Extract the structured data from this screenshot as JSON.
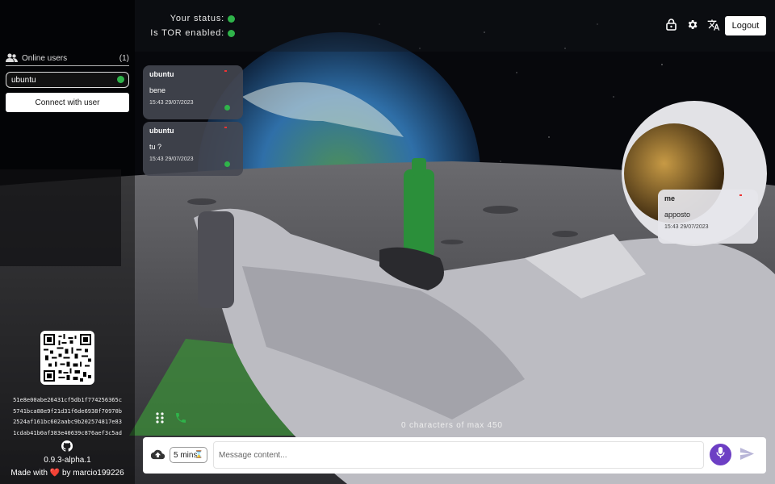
{
  "app": {
    "status_label": "Your status:",
    "tor_label": "Is TOR enabled:",
    "logout_label": "Logout",
    "icons": [
      "lock-icon",
      "gear-icon",
      "translate-icon"
    ]
  },
  "sidebar": {
    "online_users_label": "Online users",
    "online_users_count": "(1)",
    "users": [
      {
        "name": "ubuntu",
        "status_color": "#2fb34a"
      }
    ],
    "connect_label": "Connect with user",
    "fingerprint": [
      "51e8e00abe26431cf5db1f774256365c",
      "5741bca88e9f21d31f6de6938f70970b",
      "2524af161bc602aabc9b202574817e83",
      "1cdab41b0af383e40639c876aef3c5ad"
    ],
    "version": "0.9.3-alpha.1",
    "made_with_prefix": "Made with",
    "made_with_suffix": "by marcio199226"
  },
  "messages": [
    {
      "sender": "ubuntu",
      "text": "bene",
      "time": "15:43 29/07/2023",
      "from_me": false
    },
    {
      "sender": "ubuntu",
      "text": "tu ?",
      "time": "15:43 29/07/2023",
      "from_me": false
    },
    {
      "sender": "me",
      "text": "apposto",
      "time": "15:43 29/07/2023",
      "from_me": true
    }
  ],
  "composer": {
    "char_counter": "0 characters of max 450",
    "timer_value": "5 mins",
    "placeholder": "Message content..."
  },
  "colors": {
    "status_green": "#2fb34a",
    "mic_purple": "#6d3fc4",
    "heart_red": "#e23b3b"
  }
}
